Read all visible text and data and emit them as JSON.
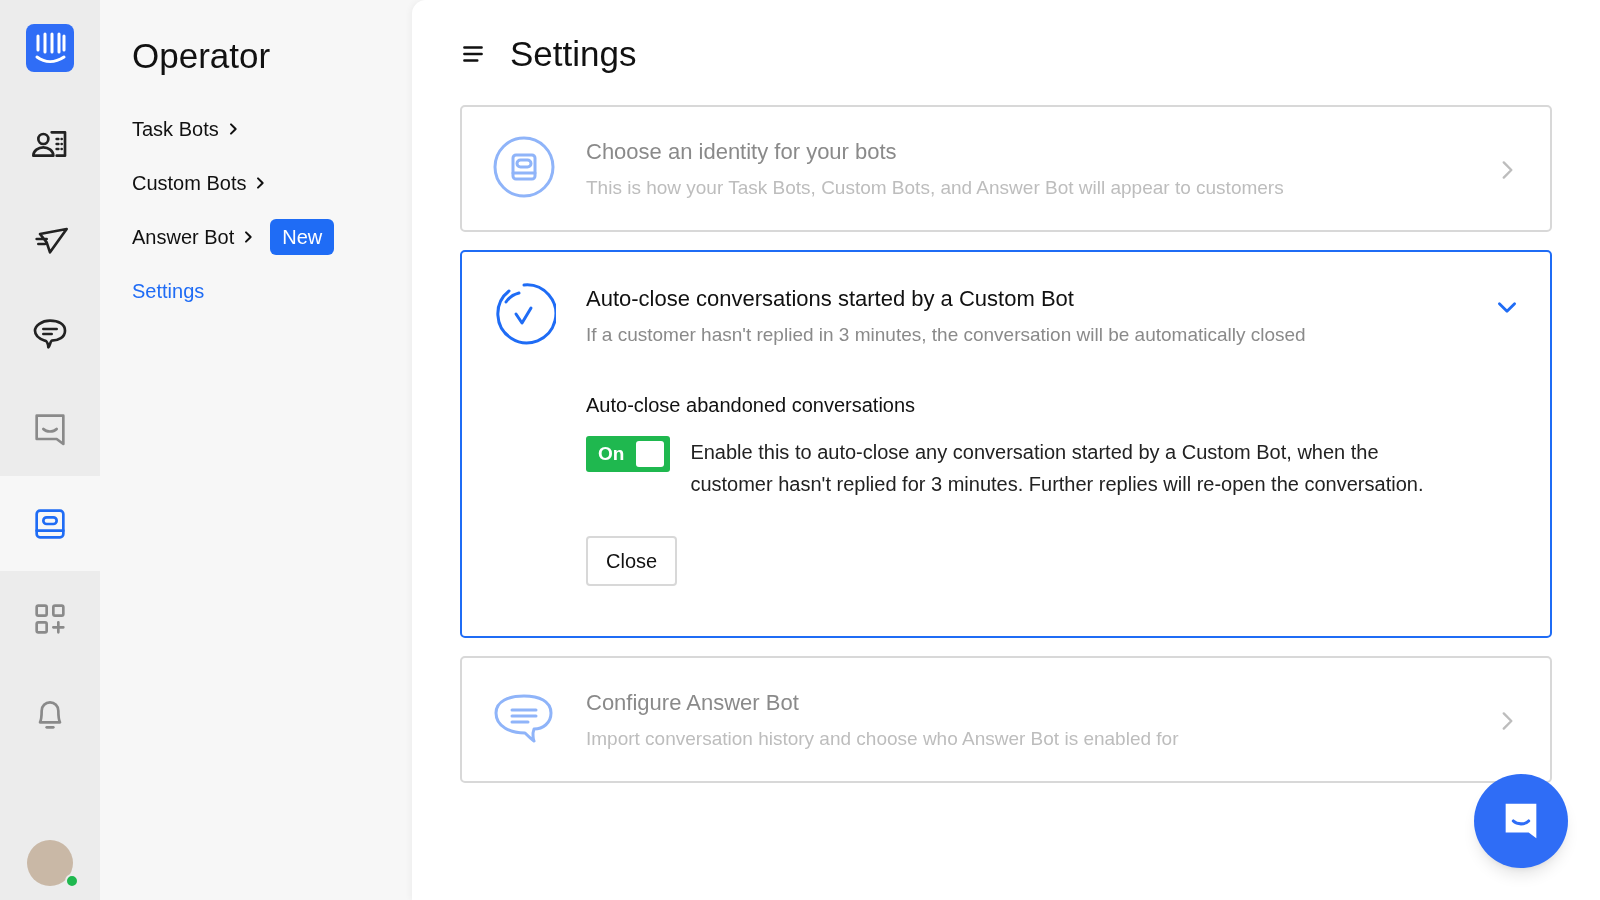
{
  "rail": {
    "items": [
      {
        "kind": "contacts",
        "selected": false
      },
      {
        "kind": "send",
        "selected": false
      },
      {
        "kind": "chat",
        "selected": false
      },
      {
        "kind": "inbox",
        "selected": false
      },
      {
        "kind": "bot",
        "selected": true
      },
      {
        "kind": "apps",
        "selected": false
      },
      {
        "kind": "bell",
        "selected": false
      }
    ],
    "user": {
      "online": true
    }
  },
  "sidebar": {
    "title": "Operator",
    "items": [
      {
        "label": "Task Bots",
        "chevron": true,
        "selected": false
      },
      {
        "label": "Custom Bots",
        "chevron": true,
        "selected": false
      },
      {
        "label": "Answer Bot",
        "chevron": true,
        "badge": "New",
        "selected": false
      },
      {
        "label": "Settings",
        "chevron": false,
        "selected": true
      }
    ]
  },
  "page": {
    "title": "Settings"
  },
  "cards": [
    {
      "title": "Choose an identity for your bots",
      "subtitle": "This is how your Task Bots, Custom Bots, and Answer Bot will appear to customers",
      "expanded": false
    },
    {
      "title": "Auto-close conversations started by a Custom Bot",
      "subtitle": "If a customer hasn't replied in 3 minutes, the conversation will be automatically closed",
      "expanded": true,
      "setting": {
        "label": "Auto-close abandoned conversations",
        "toggle": {
          "on": true,
          "label": "On"
        },
        "description": "Enable this to auto-close any conversation started by a Custom Bot, when the customer hasn't replied for 3 minutes. Further replies will re-open the conversation."
      },
      "button": "Close"
    },
    {
      "title": "Configure Answer Bot",
      "subtitle": "Import conversation history and choose who Answer Bot is enabled for",
      "expanded": false
    }
  ]
}
